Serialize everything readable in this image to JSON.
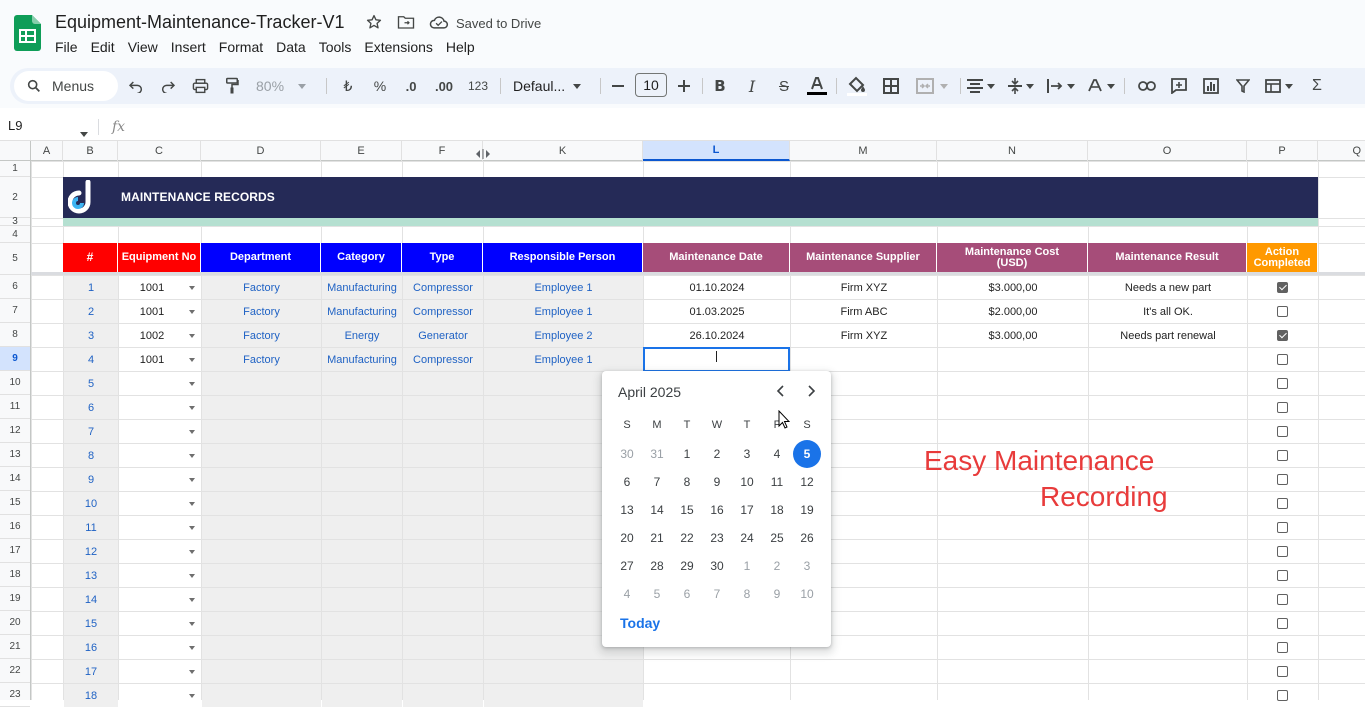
{
  "app": {
    "doc_title": "Equipment-Maintenance-Tracker-V1",
    "save_status": "Saved to Drive",
    "menu": [
      "File",
      "Edit",
      "View",
      "Insert",
      "Format",
      "Data",
      "Tools",
      "Extensions",
      "Help"
    ]
  },
  "toolbar": {
    "search_label": "Menus",
    "zoom": "80%",
    "currency_symbol": "₺",
    "percent": "%",
    "dec_decrease": ".0",
    "dec_increase": ".00",
    "number_format": "123",
    "font_name": "Defaul...",
    "font_size": "10",
    "icons": [
      "undo-icon",
      "redo-icon",
      "print-icon",
      "paint-format-icon",
      "bold-icon",
      "italic-icon",
      "strikethrough-icon",
      "text-color-icon",
      "fill-color-icon",
      "borders-icon",
      "merge-icon",
      "align-icon",
      "valign-icon",
      "wrap-icon",
      "rotate-icon",
      "link-icon",
      "comment-icon",
      "chart-icon",
      "filter-icon",
      "table-icon",
      "functions-icon"
    ]
  },
  "formula_bar": {
    "cell_ref": "L9",
    "fx": "fx"
  },
  "columns": {
    "letters": [
      "A",
      "B",
      "C",
      "D",
      "E",
      "F",
      "K",
      "L",
      "M",
      "N",
      "O",
      "P",
      "Q"
    ],
    "selected": "L"
  },
  "rows": {
    "numbers": [
      "1",
      "2",
      "3",
      "4",
      "5",
      "6",
      "7",
      "8",
      "9",
      "10",
      "11",
      "12",
      "13",
      "14",
      "15",
      "16",
      "17",
      "18",
      "19",
      "20",
      "21",
      "22",
      "23"
    ],
    "selected": "9"
  },
  "sheet": {
    "banner_title": "MAINTENANCE RECORDS",
    "headers": {
      "num": "#",
      "equipment_no": "Equipment No",
      "department": "Department",
      "category": "Category",
      "type": "Type",
      "responsible": "Responsible Person",
      "maint_date": "Maintenance Date",
      "supplier": "Maintenance Supplier",
      "cost_line1": "Maintenance Cost",
      "cost_line2": "(USD)",
      "result": "Maintenance Result",
      "action_line1": "Action",
      "action_line2": "Completed"
    },
    "records": [
      {
        "num": "1",
        "equipment_no": "1001",
        "department": "Factory",
        "category": "Manufacturing",
        "type": "Compressor",
        "responsible": "Employee 1",
        "date": "01.10.2024",
        "supplier": "Firm XYZ",
        "cost": "$3.000,00",
        "result": "Needs a new part",
        "completed": true
      },
      {
        "num": "2",
        "equipment_no": "1001",
        "department": "Factory",
        "category": "Manufacturing",
        "type": "Compressor",
        "responsible": "Employee 1",
        "date": "01.03.2025",
        "supplier": "Firm ABC",
        "cost": "$2.000,00",
        "result": "It's all OK.",
        "completed": false
      },
      {
        "num": "3",
        "equipment_no": "1002",
        "department": "Factory",
        "category": "Energy",
        "type": "Generator",
        "responsible": "Employee 2",
        "date": "26.10.2024",
        "supplier": "Firm XYZ",
        "cost": "$3.000,00",
        "result": "Needs part renewal",
        "completed": true
      },
      {
        "num": "4",
        "equipment_no": "1001",
        "department": "Factory",
        "category": "Manufacturing",
        "type": "Compressor",
        "responsible": "Employee 1",
        "date": "",
        "supplier": "",
        "cost": "",
        "result": "",
        "completed": false
      }
    ],
    "empty_nums": [
      "5",
      "6",
      "7",
      "8",
      "9",
      "10",
      "11",
      "12",
      "13",
      "14",
      "15",
      "16",
      "17",
      "18"
    ]
  },
  "date_picker": {
    "month_label": "April 2025",
    "weekdays": [
      "S",
      "M",
      "T",
      "W",
      "T",
      "F",
      "S"
    ],
    "weeks": [
      [
        "30",
        "31",
        "1",
        "2",
        "3",
        "4",
        "5"
      ],
      [
        "6",
        "7",
        "8",
        "9",
        "10",
        "11",
        "12"
      ],
      [
        "13",
        "14",
        "15",
        "16",
        "17",
        "18",
        "19"
      ],
      [
        "20",
        "21",
        "22",
        "23",
        "24",
        "25",
        "26"
      ],
      [
        "27",
        "28",
        "29",
        "30",
        "1",
        "2",
        "3"
      ],
      [
        "4",
        "5",
        "6",
        "7",
        "8",
        "9",
        "10"
      ]
    ],
    "selected_day": "5",
    "today_label": "Today"
  },
  "overlay": {
    "line1": "Easy Maintenance",
    "line2": "Recording"
  },
  "colors": {
    "banner": "#252a57",
    "header_red": "#ff0000",
    "header_blue": "#0000ff",
    "header_mauve": "#a64d79",
    "header_orange": "#ff9900",
    "accent_blue": "#1a73e8",
    "promo_red": "#e83b3b"
  }
}
